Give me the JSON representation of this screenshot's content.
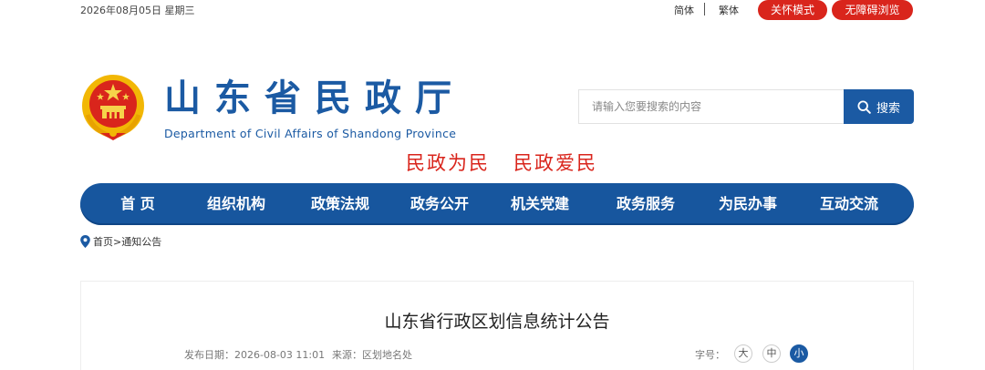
{
  "topbar": {
    "date": "2026年08月05日 星期三",
    "lang_simplified": "简体",
    "lang_traditional": "繁体",
    "care_mode": "关怀模式",
    "accessible": "无障碍浏览"
  },
  "header": {
    "title": "山东省民政厅",
    "subtitle": "Department of Civil Affairs of Shandong Province",
    "slogan": "民政为民   民政爱民",
    "emblem_icon": "national-emblem-icon"
  },
  "search": {
    "placeholder": "请输入您要搜索的内容",
    "button_label": "搜索",
    "icon": "search-icon"
  },
  "nav": {
    "items": [
      {
        "label": "首 页"
      },
      {
        "label": "组织机构"
      },
      {
        "label": "政策法规"
      },
      {
        "label": "政务公开"
      },
      {
        "label": "机关党建"
      },
      {
        "label": "政务服务"
      },
      {
        "label": "为民办事"
      },
      {
        "label": "互动交流"
      }
    ]
  },
  "breadcrumb": {
    "icon": "location-pin-icon",
    "home": "首页",
    "separator": ">",
    "current": "通知公告"
  },
  "article": {
    "title": "山东省行政区划信息统计公告",
    "date_text": "发布日期：2026-08-03 11:01",
    "source_text": "来源：区划地名处",
    "font_size_label": "字号：",
    "font_large": "大",
    "font_medium": "中",
    "font_small": "小"
  },
  "colors": {
    "brand_blue": "#1b5aa3",
    "accent_red": "#d9251c"
  }
}
